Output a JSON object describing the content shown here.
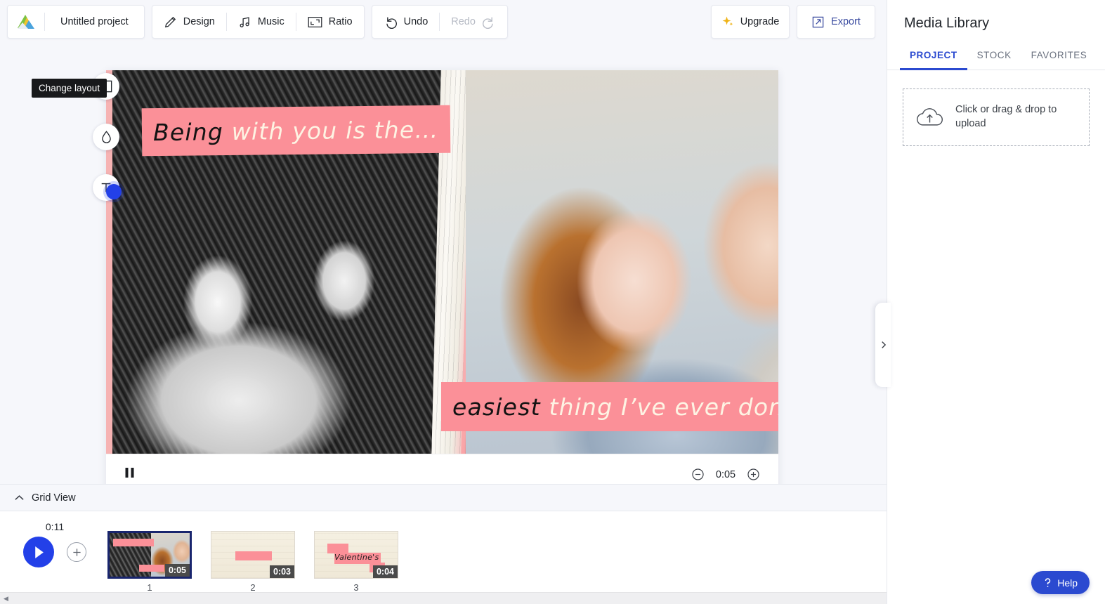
{
  "app": {
    "background_color": "#f6f7fb",
    "accent_color": "#2340e8",
    "caption_highlight_color": "#fb9098"
  },
  "toolbar": {
    "logo_icon": "mountain-logo-icon",
    "project_name": "Untitled project",
    "design_label": "Design",
    "design_icon": "pen-icon",
    "music_label": "Music",
    "music_icon": "music-note-icon",
    "ratio_label": "Ratio",
    "ratio_icon": "crop-frame-icon",
    "undo_label": "Undo",
    "undo_icon": "undo-arrow-icon",
    "redo_label": "Redo",
    "redo_icon": "redo-arrow-icon",
    "redo_disabled": true,
    "upgrade_label": "Upgrade",
    "upgrade_icon": "sparkle-icon",
    "export_label": "Export",
    "export_icon": "external-link-icon"
  },
  "canvas": {
    "tools": [
      {
        "name": "change-layout",
        "icon": "layout-grid-icon"
      },
      {
        "name": "filter",
        "icon": "droplet-icon"
      },
      {
        "name": "text",
        "icon": "text-t-icon"
      }
    ],
    "tooltip": "Change layout",
    "captions": [
      {
        "dark_text": "Being",
        "light_text": "with you is the…"
      },
      {
        "dark_text": "easiest",
        "light_text": "thing I’ve ever done"
      }
    ]
  },
  "player": {
    "pause_icon": "pause-icon",
    "zoom_out_icon": "minus-circle-icon",
    "zoom_in_icon": "plus-circle-icon",
    "current_time": "0:05"
  },
  "panel_collapse": {
    "icon": "chevron-right-icon"
  },
  "grid_view": {
    "label": "Grid View",
    "icon": "chevron-up-icon"
  },
  "timeline": {
    "total_duration": "0:11",
    "play_icon": "play-icon",
    "add_scene_icon": "plus-icon",
    "scroll_left_icon": "caret-left-icon",
    "scenes": [
      {
        "number": "1",
        "duration": "0:05",
        "selected": true,
        "caption_text": ""
      },
      {
        "number": "2",
        "duration": "0:03",
        "selected": false,
        "caption_text": ""
      },
      {
        "number": "3",
        "duration": "0:04",
        "selected": false,
        "caption_text": "Valentine's"
      }
    ]
  },
  "media_library": {
    "title": "Media Library",
    "tabs": [
      {
        "label": "PROJECT",
        "active": true
      },
      {
        "label": "STOCK",
        "active": false
      },
      {
        "label": "FAVORITES",
        "active": false
      }
    ],
    "dropzone": {
      "icon": "cloud-upload-icon",
      "text": "Click or drag & drop to upload"
    }
  },
  "help": {
    "label": "Help",
    "icon": "question-mark-icon"
  }
}
